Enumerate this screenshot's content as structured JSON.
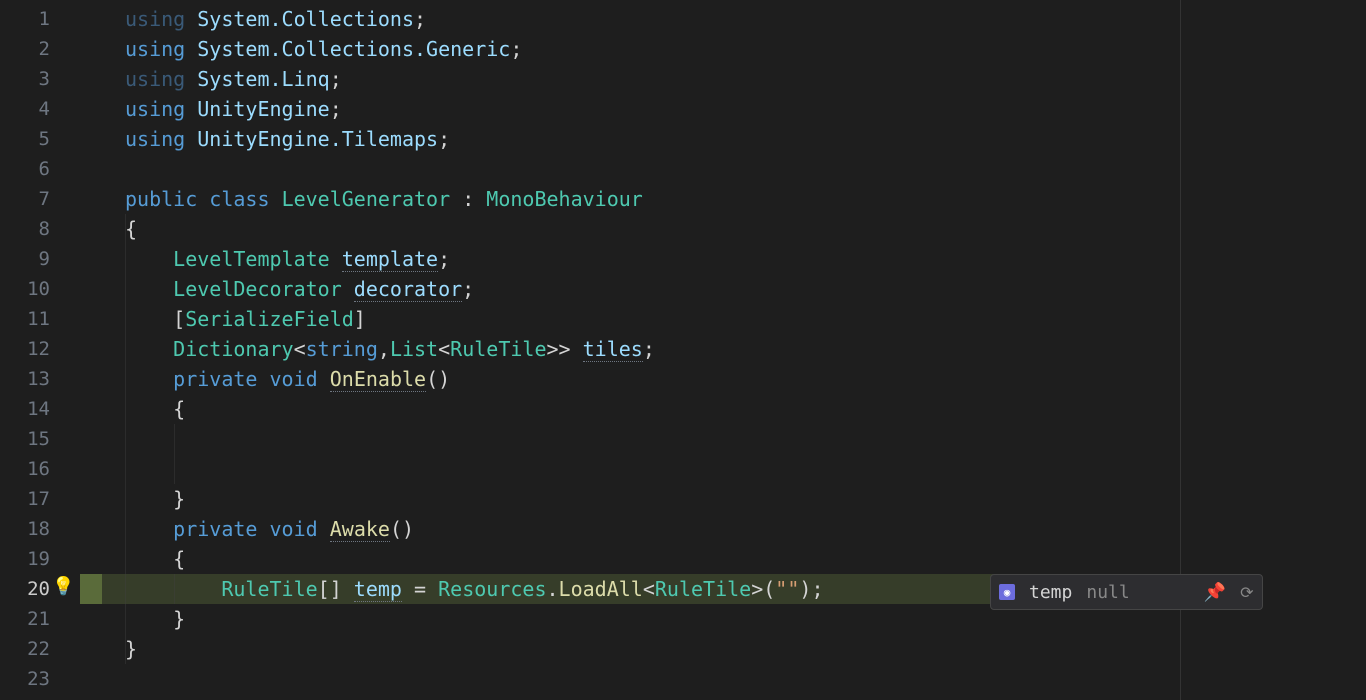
{
  "lines": {
    "l1": {
      "n": "1"
    },
    "l2": {
      "n": "2"
    },
    "l3": {
      "n": "3"
    },
    "l4": {
      "n": "4"
    },
    "l5": {
      "n": "5"
    },
    "l6": {
      "n": "6"
    },
    "l7": {
      "n": "7"
    },
    "l8": {
      "n": "8"
    },
    "l9": {
      "n": "9"
    },
    "l10": {
      "n": "10"
    },
    "l11": {
      "n": "11"
    },
    "l12": {
      "n": "12"
    },
    "l13": {
      "n": "13"
    },
    "l14": {
      "n": "14"
    },
    "l15": {
      "n": "15"
    },
    "l16": {
      "n": "16"
    },
    "l17": {
      "n": "17"
    },
    "l18": {
      "n": "18"
    },
    "l19": {
      "n": "19"
    },
    "l20": {
      "n": "20"
    },
    "l21": {
      "n": "21"
    },
    "l22": {
      "n": "22"
    },
    "l23": {
      "n": "23"
    }
  },
  "tokens": {
    "using": "using",
    "public": "public",
    "class": "class",
    "private": "private",
    "void": "void",
    "ns1": "System.Collections",
    "ns2": "System.Collections.Generic",
    "ns3": "System.Linq",
    "ns4": "UnityEngine",
    "ns5": "UnityEngine.Tilemaps",
    "LevelGenerator": "LevelGenerator",
    "MonoBehaviour": "MonoBehaviour",
    "LevelTemplate": "LevelTemplate",
    "template": "template",
    "LevelDecorator": "LevelDecorator",
    "decorator": "decorator",
    "SerializeField": "SerializeField",
    "Dictionary": "Dictionary",
    "string": "string",
    "List": "List",
    "RuleTile": "RuleTile",
    "tiles": "tiles",
    "OnEnable": "OnEnable",
    "Awake": "Awake",
    "temp": "temp",
    "Resources": "Resources",
    "LoadAll": "LoadAll",
    "emptystr": "\"\"",
    "brace_open": "{",
    "brace_close": "}",
    "paren_open": "(",
    "paren_close": ")",
    "bracket_open": "[",
    "bracket_close": "]",
    "arr": "[]",
    "lt": "<",
    "gt": ">",
    "gtgt": ">>",
    "semi": ";",
    "colon": ":",
    "comma": ",",
    "equals": "=",
    "dot": "."
  },
  "debug": {
    "var": "temp",
    "val": "null"
  }
}
